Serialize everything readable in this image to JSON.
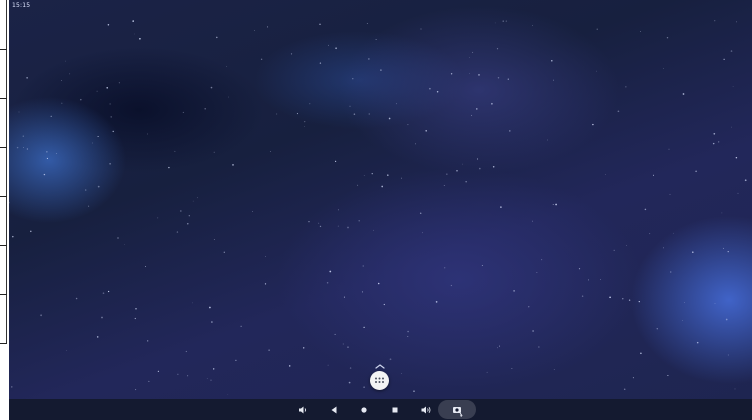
{
  "status_bar": {
    "time": "15:15"
  },
  "home": {
    "app_drawer_icon": "apps-grid-icon",
    "swipe_up_icon": "chevron-up-icon"
  },
  "nav_bar": {
    "buttons": [
      {
        "name": "volume-down-icon"
      },
      {
        "name": "back-icon"
      },
      {
        "name": "home-icon"
      },
      {
        "name": "recents-icon"
      },
      {
        "name": "volume-up-icon"
      },
      {
        "name": "screenshot-icon"
      }
    ]
  },
  "colors": {
    "wallpaper_base": "#1b2347",
    "nav_bar": "#141a30",
    "icon": "#e6e9f2"
  }
}
